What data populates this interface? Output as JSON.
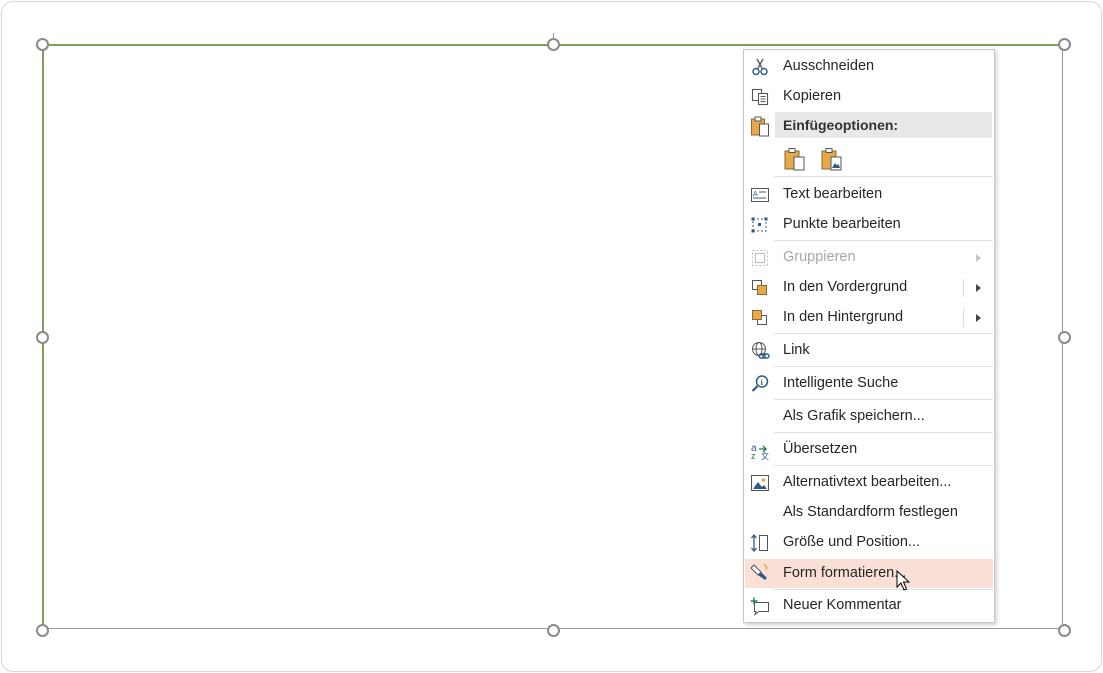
{
  "menu": {
    "cut": "Ausschneiden",
    "copy": "Kopieren",
    "paste_header": "Einfügeoptionen:",
    "edit_text": "Text bearbeiten",
    "edit_points": "Punkte bearbeiten",
    "group": "Gruppieren",
    "bring_forward": "In den Vordergrund",
    "send_backward": "In den Hintergrund",
    "link": "Link",
    "smart_lookup": "Intelligente Suche",
    "save_as_picture": "Als Grafik speichern...",
    "translate": "Übersetzen",
    "edit_alt_text": "Alternativtext bearbeiten...",
    "set_default_shape": "Als Standardform festlegen",
    "size_position": "Größe und Position...",
    "format_shape": "Form formatieren...",
    "new_comment": "Neuer Kommentar"
  },
  "icons": {
    "cut": "scissors-icon",
    "copy": "copy-icon",
    "paste": "clipboard-icon",
    "edit_text": "text-box-icon",
    "edit_points": "edit-points-icon",
    "group": "group-icon",
    "bring_forward": "bring-forward-icon",
    "send_backward": "send-backward-icon",
    "link": "link-globe-icon",
    "smart_lookup": "smart-lookup-icon",
    "translate": "translate-icon",
    "alt_text": "alt-text-icon",
    "size_position": "size-position-icon",
    "format_shape": "format-shape-icon",
    "new_comment": "new-comment-icon"
  },
  "colors": {
    "selection_border": "#7aa05c",
    "hover_highlight": "#fbe0d8",
    "header_bg": "#e8e8e8",
    "paste_orange": "#e8a94a"
  }
}
